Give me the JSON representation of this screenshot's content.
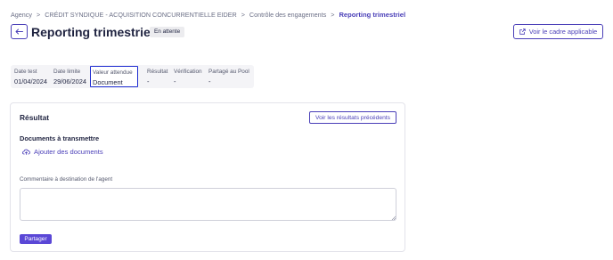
{
  "breadcrumb": {
    "items": [
      "Agency",
      "CRÉDIT SYNDIQUE - ACQUISITION CONCURRENTIELLE EIDER",
      "Contrôle des engagements"
    ],
    "separator": ">",
    "current": "Reporting trimestriel"
  },
  "header": {
    "back_icon": "arrow-left-icon",
    "title": "Reporting trimestriel",
    "status": "En attente",
    "cadre_button": {
      "label": "Voir le cadre applicable",
      "icon": "external-link-icon"
    }
  },
  "info": {
    "columns": [
      {
        "label": "Date test",
        "value": "01/04/2024"
      },
      {
        "label": "Date limite",
        "value": "29/06/2024"
      },
      {
        "label": "Valeur attendue",
        "value": "Document",
        "highlighted": true
      },
      {
        "label": "Résultat",
        "value": "-"
      },
      {
        "label": "Vérification",
        "value": "-"
      },
      {
        "label": "Partagé au Pool",
        "value": "-"
      }
    ]
  },
  "result_card": {
    "title": "Résultat",
    "previous_results_button": "Voir les résultats précédents",
    "documents_title": "Documents à transmettre",
    "add_documents": {
      "label": "Ajouter des documents",
      "icon": "cloud-upload-icon"
    },
    "comment_label": "Commentaire à destination de l'agent",
    "comment_value": "",
    "share_button": "Partager"
  },
  "colors": {
    "accent": "#4a3fb8",
    "primary_button": "#5a47d6",
    "highlight_border": "#1d2bd1",
    "badge_bg": "#ececef",
    "strip_bg": "#f4f4f7"
  }
}
